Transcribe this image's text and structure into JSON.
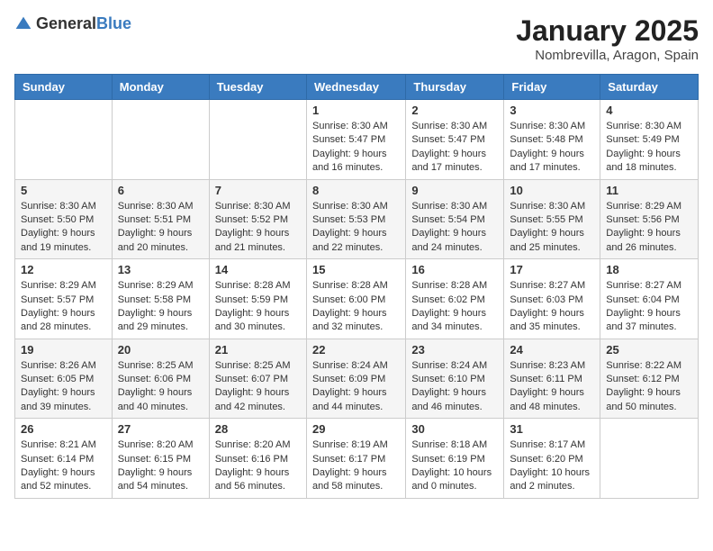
{
  "logo": {
    "general": "General",
    "blue": "Blue"
  },
  "header": {
    "month": "January 2025",
    "location": "Nombrevilla, Aragon, Spain"
  },
  "weekdays": [
    "Sunday",
    "Monday",
    "Tuesday",
    "Wednesday",
    "Thursday",
    "Friday",
    "Saturday"
  ],
  "weeks": [
    [
      {
        "day": "",
        "sunrise": "",
        "sunset": "",
        "daylight": ""
      },
      {
        "day": "",
        "sunrise": "",
        "sunset": "",
        "daylight": ""
      },
      {
        "day": "",
        "sunrise": "",
        "sunset": "",
        "daylight": ""
      },
      {
        "day": "1",
        "sunrise": "Sunrise: 8:30 AM",
        "sunset": "Sunset: 5:47 PM",
        "daylight": "Daylight: 9 hours and 16 minutes."
      },
      {
        "day": "2",
        "sunrise": "Sunrise: 8:30 AM",
        "sunset": "Sunset: 5:47 PM",
        "daylight": "Daylight: 9 hours and 17 minutes."
      },
      {
        "day": "3",
        "sunrise": "Sunrise: 8:30 AM",
        "sunset": "Sunset: 5:48 PM",
        "daylight": "Daylight: 9 hours and 17 minutes."
      },
      {
        "day": "4",
        "sunrise": "Sunrise: 8:30 AM",
        "sunset": "Sunset: 5:49 PM",
        "daylight": "Daylight: 9 hours and 18 minutes."
      }
    ],
    [
      {
        "day": "5",
        "sunrise": "Sunrise: 8:30 AM",
        "sunset": "Sunset: 5:50 PM",
        "daylight": "Daylight: 9 hours and 19 minutes."
      },
      {
        "day": "6",
        "sunrise": "Sunrise: 8:30 AM",
        "sunset": "Sunset: 5:51 PM",
        "daylight": "Daylight: 9 hours and 20 minutes."
      },
      {
        "day": "7",
        "sunrise": "Sunrise: 8:30 AM",
        "sunset": "Sunset: 5:52 PM",
        "daylight": "Daylight: 9 hours and 21 minutes."
      },
      {
        "day": "8",
        "sunrise": "Sunrise: 8:30 AM",
        "sunset": "Sunset: 5:53 PM",
        "daylight": "Daylight: 9 hours and 22 minutes."
      },
      {
        "day": "9",
        "sunrise": "Sunrise: 8:30 AM",
        "sunset": "Sunset: 5:54 PM",
        "daylight": "Daylight: 9 hours and 24 minutes."
      },
      {
        "day": "10",
        "sunrise": "Sunrise: 8:30 AM",
        "sunset": "Sunset: 5:55 PM",
        "daylight": "Daylight: 9 hours and 25 minutes."
      },
      {
        "day": "11",
        "sunrise": "Sunrise: 8:29 AM",
        "sunset": "Sunset: 5:56 PM",
        "daylight": "Daylight: 9 hours and 26 minutes."
      }
    ],
    [
      {
        "day": "12",
        "sunrise": "Sunrise: 8:29 AM",
        "sunset": "Sunset: 5:57 PM",
        "daylight": "Daylight: 9 hours and 28 minutes."
      },
      {
        "day": "13",
        "sunrise": "Sunrise: 8:29 AM",
        "sunset": "Sunset: 5:58 PM",
        "daylight": "Daylight: 9 hours and 29 minutes."
      },
      {
        "day": "14",
        "sunrise": "Sunrise: 8:28 AM",
        "sunset": "Sunset: 5:59 PM",
        "daylight": "Daylight: 9 hours and 30 minutes."
      },
      {
        "day": "15",
        "sunrise": "Sunrise: 8:28 AM",
        "sunset": "Sunset: 6:00 PM",
        "daylight": "Daylight: 9 hours and 32 minutes."
      },
      {
        "day": "16",
        "sunrise": "Sunrise: 8:28 AM",
        "sunset": "Sunset: 6:02 PM",
        "daylight": "Daylight: 9 hours and 34 minutes."
      },
      {
        "day": "17",
        "sunrise": "Sunrise: 8:27 AM",
        "sunset": "Sunset: 6:03 PM",
        "daylight": "Daylight: 9 hours and 35 minutes."
      },
      {
        "day": "18",
        "sunrise": "Sunrise: 8:27 AM",
        "sunset": "Sunset: 6:04 PM",
        "daylight": "Daylight: 9 hours and 37 minutes."
      }
    ],
    [
      {
        "day": "19",
        "sunrise": "Sunrise: 8:26 AM",
        "sunset": "Sunset: 6:05 PM",
        "daylight": "Daylight: 9 hours and 39 minutes."
      },
      {
        "day": "20",
        "sunrise": "Sunrise: 8:25 AM",
        "sunset": "Sunset: 6:06 PM",
        "daylight": "Daylight: 9 hours and 40 minutes."
      },
      {
        "day": "21",
        "sunrise": "Sunrise: 8:25 AM",
        "sunset": "Sunset: 6:07 PM",
        "daylight": "Daylight: 9 hours and 42 minutes."
      },
      {
        "day": "22",
        "sunrise": "Sunrise: 8:24 AM",
        "sunset": "Sunset: 6:09 PM",
        "daylight": "Daylight: 9 hours and 44 minutes."
      },
      {
        "day": "23",
        "sunrise": "Sunrise: 8:24 AM",
        "sunset": "Sunset: 6:10 PM",
        "daylight": "Daylight: 9 hours and 46 minutes."
      },
      {
        "day": "24",
        "sunrise": "Sunrise: 8:23 AM",
        "sunset": "Sunset: 6:11 PM",
        "daylight": "Daylight: 9 hours and 48 minutes."
      },
      {
        "day": "25",
        "sunrise": "Sunrise: 8:22 AM",
        "sunset": "Sunset: 6:12 PM",
        "daylight": "Daylight: 9 hours and 50 minutes."
      }
    ],
    [
      {
        "day": "26",
        "sunrise": "Sunrise: 8:21 AM",
        "sunset": "Sunset: 6:14 PM",
        "daylight": "Daylight: 9 hours and 52 minutes."
      },
      {
        "day": "27",
        "sunrise": "Sunrise: 8:20 AM",
        "sunset": "Sunset: 6:15 PM",
        "daylight": "Daylight: 9 hours and 54 minutes."
      },
      {
        "day": "28",
        "sunrise": "Sunrise: 8:20 AM",
        "sunset": "Sunset: 6:16 PM",
        "daylight": "Daylight: 9 hours and 56 minutes."
      },
      {
        "day": "29",
        "sunrise": "Sunrise: 8:19 AM",
        "sunset": "Sunset: 6:17 PM",
        "daylight": "Daylight: 9 hours and 58 minutes."
      },
      {
        "day": "30",
        "sunrise": "Sunrise: 8:18 AM",
        "sunset": "Sunset: 6:19 PM",
        "daylight": "Daylight: 10 hours and 0 minutes."
      },
      {
        "day": "31",
        "sunrise": "Sunrise: 8:17 AM",
        "sunset": "Sunset: 6:20 PM",
        "daylight": "Daylight: 10 hours and 2 minutes."
      },
      {
        "day": "",
        "sunrise": "",
        "sunset": "",
        "daylight": ""
      }
    ]
  ]
}
